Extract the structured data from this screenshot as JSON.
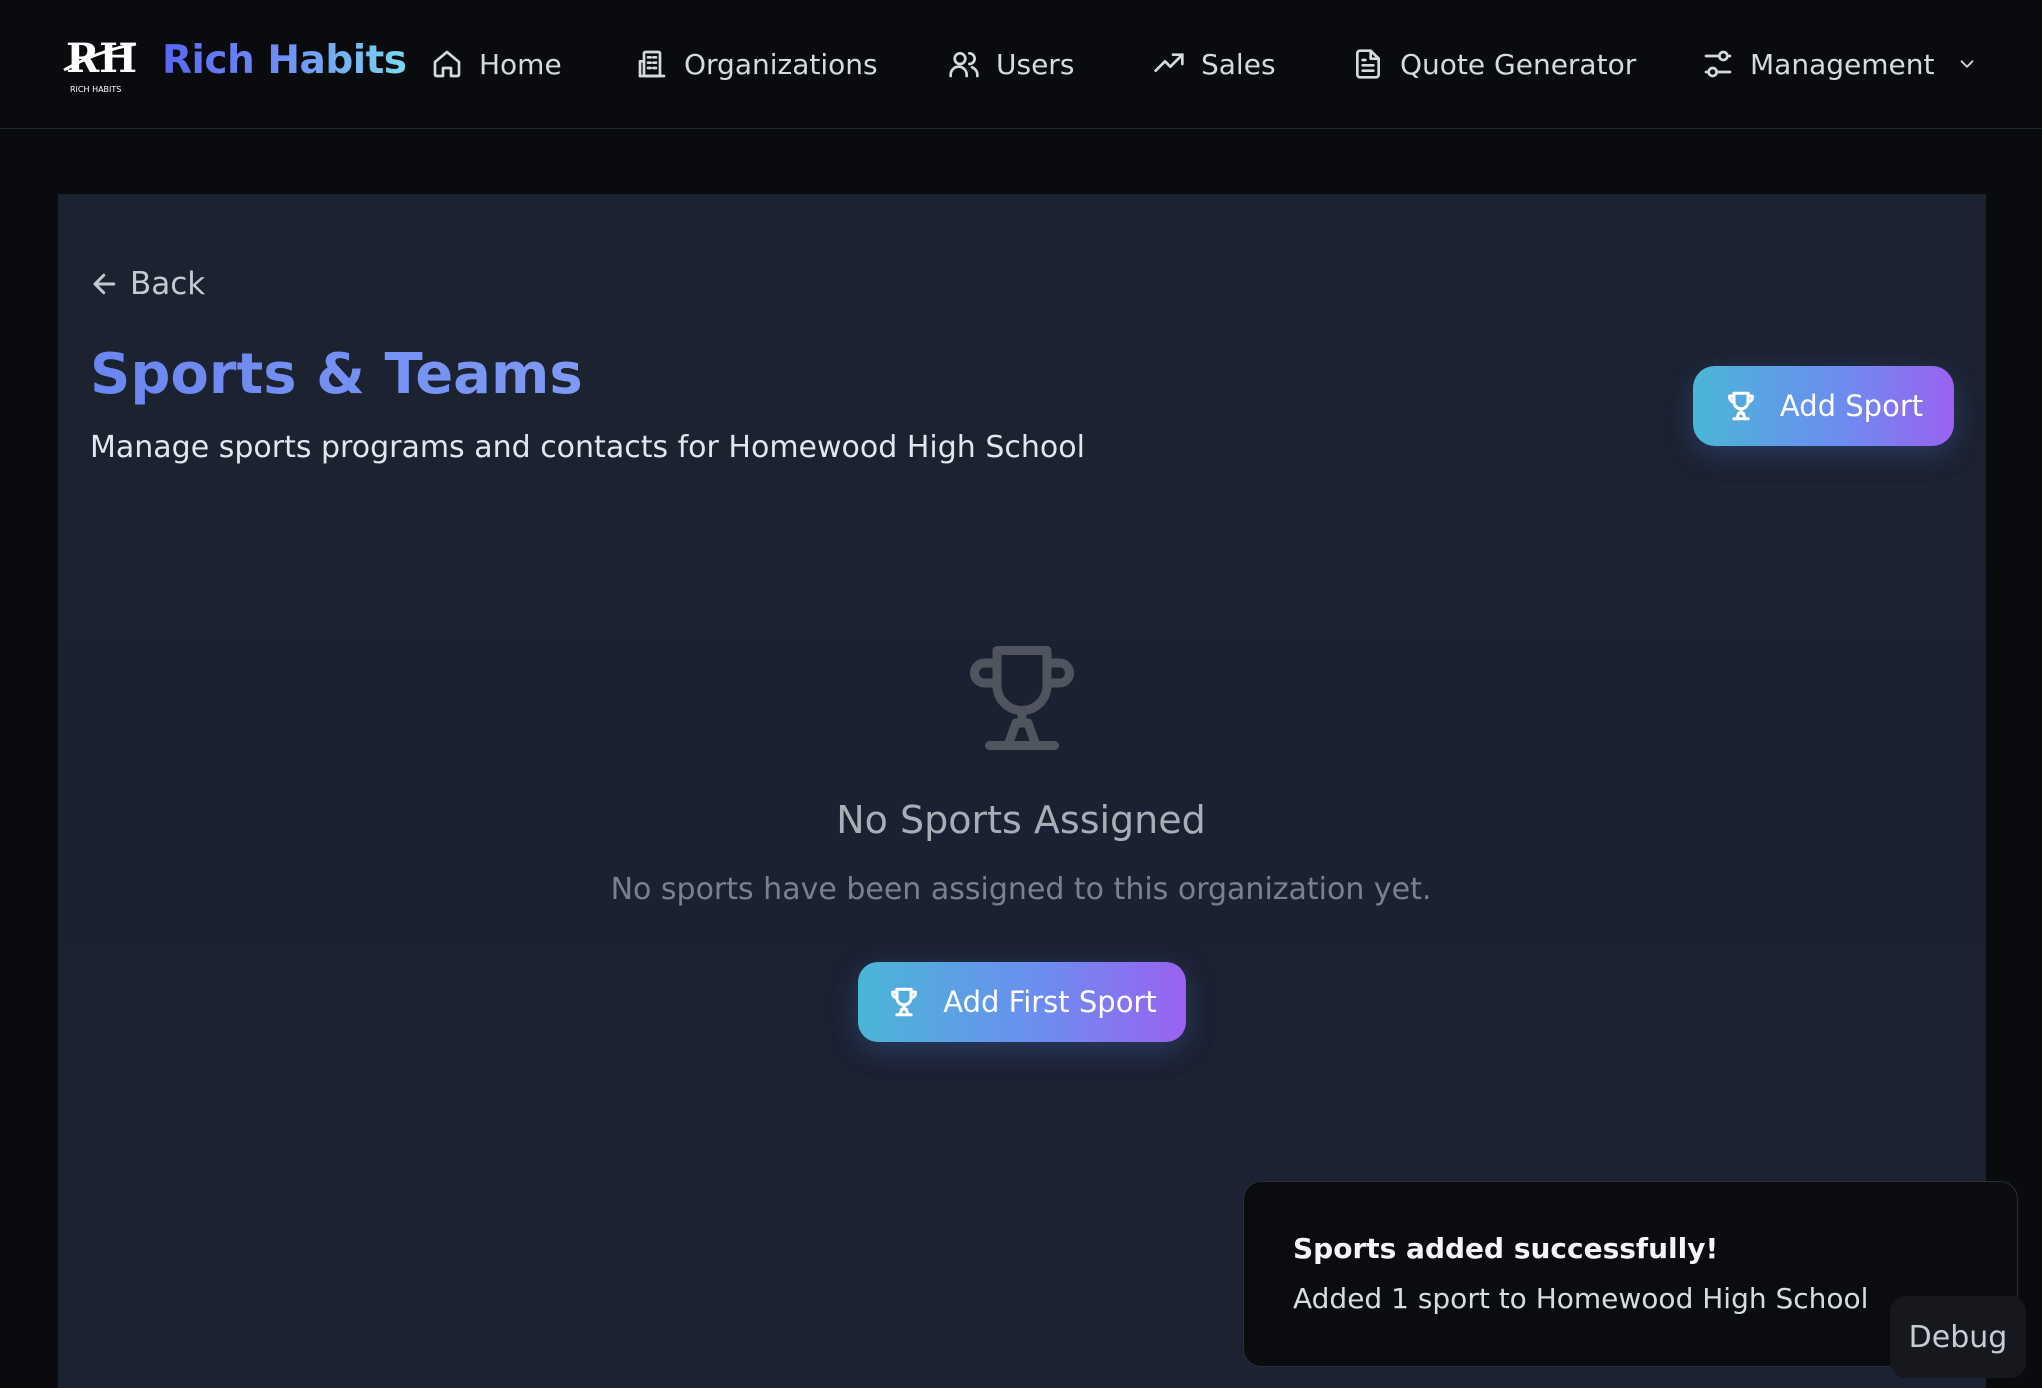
{
  "app": {
    "brand": "Rich Habits",
    "logo_text": "RH",
    "logo_subtext": "RICH HABITS"
  },
  "nav": {
    "items": [
      {
        "label": "Home",
        "icon": "home-icon"
      },
      {
        "label": "Organizations",
        "icon": "building-icon"
      },
      {
        "label": "Users",
        "icon": "users-icon"
      },
      {
        "label": "Sales",
        "icon": "trending-up-icon"
      },
      {
        "label": "Quote Generator",
        "icon": "file-text-icon"
      },
      {
        "label": "Management",
        "icon": "sliders-icon"
      }
    ]
  },
  "page": {
    "back_label": "Back",
    "title": "Sports & Teams",
    "subtitle": "Manage sports programs and contacts for Homewood High School",
    "add_sport_label": "Add Sport"
  },
  "empty_state": {
    "icon": "trophy-icon",
    "title": "No Sports Assigned",
    "text": "No sports have been assigned to this organization yet.",
    "button_label": "Add First Sport"
  },
  "toast": {
    "title": "Sports added successfully!",
    "text": "Added 1 sport to Homewood High School"
  },
  "debug_label": "Debug",
  "colors": {
    "background": "#0a0b0f",
    "panel": "#1b2230",
    "accent_start": "#4ab6d6",
    "accent_end": "#9a62f0"
  }
}
